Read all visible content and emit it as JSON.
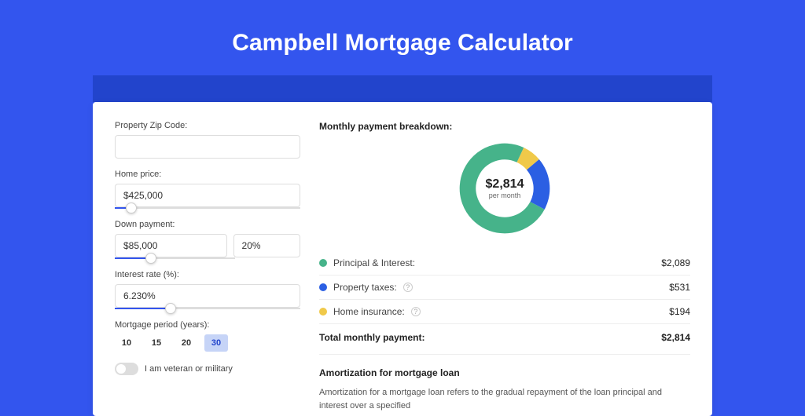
{
  "page": {
    "title": "Campbell Mortgage Calculator"
  },
  "form": {
    "zip_label": "Property Zip Code:",
    "zip_value": "",
    "home_price_label": "Home price:",
    "home_price_value": "$425,000",
    "home_price_pct": 9,
    "down_label": "Down payment:",
    "down_value": "$85,000",
    "down_pct_value": "20%",
    "down_pct": 20,
    "rate_label": "Interest rate (%):",
    "rate_value": "6.230%",
    "rate_pct": 30,
    "period_label": "Mortgage period (years):",
    "periods": [
      "10",
      "15",
      "20",
      "30"
    ],
    "period_selected": 3,
    "veteran_label": "I am veteran or military",
    "veteran_on": false
  },
  "breakdown": {
    "title": "Monthly payment breakdown:",
    "center_amount": "$2,814",
    "center_sub": "per month",
    "items": [
      {
        "label": "Principal & Interest:",
        "value": "$2,089",
        "color": "#46b38a",
        "info": false
      },
      {
        "label": "Property taxes:",
        "value": "$531",
        "color": "#2b5fe3",
        "info": true
      },
      {
        "label": "Home insurance:",
        "value": "$194",
        "color": "#f0c94a",
        "info": true
      }
    ],
    "total_label": "Total monthly payment:",
    "total_value": "$2,814"
  },
  "amort": {
    "title": "Amortization for mortgage loan",
    "body": "Amortization for a mortgage loan refers to the gradual repayment of the loan principal and interest over a specified"
  },
  "chart_data": {
    "type": "pie",
    "title": "Monthly payment breakdown",
    "series": [
      {
        "name": "Principal & Interest",
        "value": 2089,
        "color": "#46b38a"
      },
      {
        "name": "Property taxes",
        "value": 531,
        "color": "#2b5fe3"
      },
      {
        "name": "Home insurance",
        "value": 194,
        "color": "#f0c94a"
      }
    ],
    "total": 2814,
    "center_label": "$2,814 per month"
  }
}
